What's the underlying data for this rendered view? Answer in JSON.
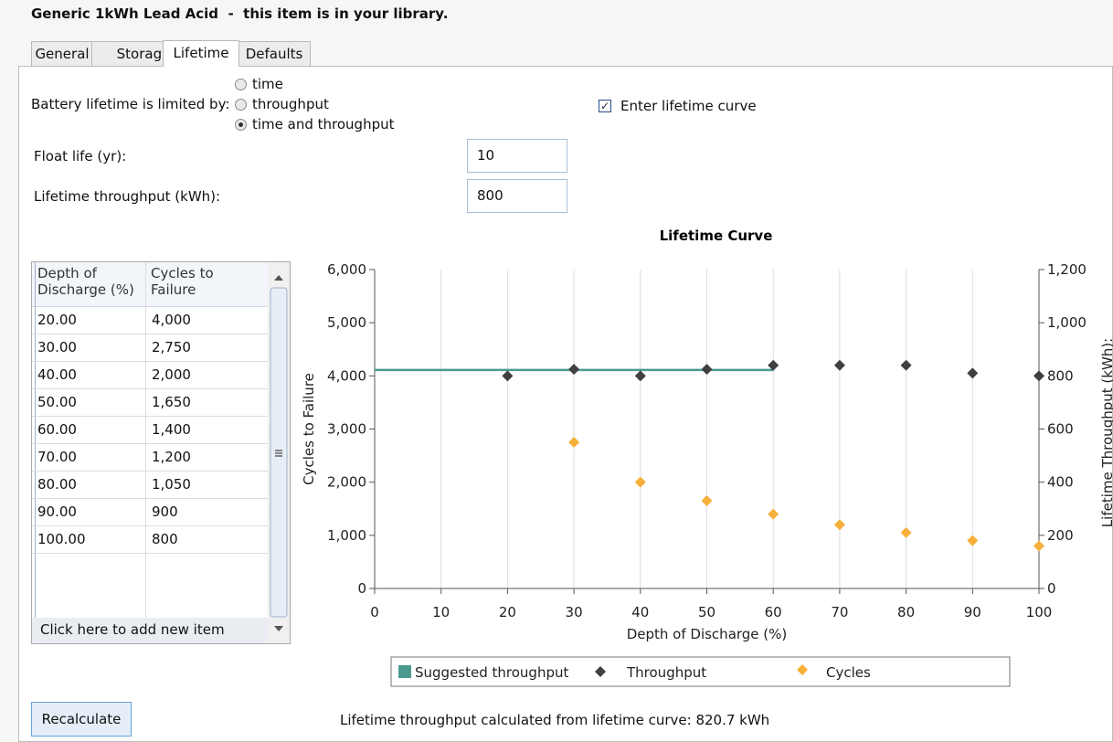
{
  "header": {
    "title": "Generic 1kWh Lead Acid  -  this item is in your library."
  },
  "tabs": [
    {
      "label": "General"
    },
    {
      "label": "Storage"
    },
    {
      "label": "Lifetime",
      "active": true
    },
    {
      "label": "Defaults"
    }
  ],
  "lifetime": {
    "limited_by_label": "Battery lifetime is limited by:",
    "options": [
      {
        "label": "time",
        "selected": false
      },
      {
        "label": "throughput",
        "selected": false
      },
      {
        "label": "time and throughput",
        "selected": true
      }
    ],
    "enter_curve_label": "Enter lifetime curve",
    "enter_curve_checked": true,
    "float_life_label": "Float life (yr):",
    "float_life_value": "10",
    "throughput_label": "Lifetime throughput (kWh):",
    "throughput_value": "800"
  },
  "table": {
    "col1_line1": "Depth of",
    "col1_line2": "Discharge (%)",
    "col2_line1": "Cycles to",
    "col2_line2": "Failure",
    "rows": [
      [
        "20.00",
        "4,000"
      ],
      [
        "30.00",
        "2,750"
      ],
      [
        "40.00",
        "2,000"
      ],
      [
        "50.00",
        "1,650"
      ],
      [
        "60.00",
        "1,400"
      ],
      [
        "70.00",
        "1,200"
      ],
      [
        "80.00",
        "1,050"
      ],
      [
        "90.00",
        "900"
      ],
      [
        "100.00",
        "800"
      ]
    ],
    "add_item_label": "Click here to add new item"
  },
  "footer": {
    "recalculate_label": "Recalculate",
    "calc_text": "Lifetime throughput calculated from lifetime curve: 820.7 kWh"
  },
  "chart_data": {
    "type": "scatter",
    "title": "Lifetime Curve",
    "xlabel": "Depth of Discharge (%)",
    "ylabel_left": "Cycles to Failure",
    "ylabel_right": "Lifetime Throughput (kWh):",
    "xlim": [
      0,
      100
    ],
    "ylim_left": [
      0,
      6000
    ],
    "ylim_right": [
      0,
      1200
    ],
    "x_ticks": [
      "0",
      "10",
      "20",
      "30",
      "40",
      "50",
      "60",
      "70",
      "80",
      "90",
      "100"
    ],
    "y_left_ticks": [
      "0",
      "1,000",
      "2,000",
      "3,000",
      "4,000",
      "5,000",
      "6,000"
    ],
    "y_right_ticks": [
      "0",
      "200",
      "400",
      "600",
      "800",
      "1,000",
      "1,200"
    ],
    "legend_position": "bottom",
    "series": [
      {
        "name": "Suggested throughput",
        "kind": "line",
        "axis": "right",
        "color": "#4a9a8f",
        "x": [
          0,
          60
        ],
        "y": [
          822,
          822
        ]
      },
      {
        "name": "Throughput",
        "kind": "marker",
        "axis": "right",
        "color": "#404040",
        "x": [
          20,
          30,
          40,
          50,
          60,
          70,
          80,
          90,
          100
        ],
        "y": [
          800,
          825,
          800,
          825,
          840,
          840,
          840,
          810,
          800
        ]
      },
      {
        "name": "Cycles",
        "kind": "marker",
        "axis": "left",
        "color": "#f6b03a",
        "x": [
          30,
          40,
          50,
          60,
          70,
          80,
          90,
          100
        ],
        "y": [
          2750,
          2000,
          1650,
          1400,
          1200,
          1050,
          900,
          800
        ]
      }
    ]
  }
}
